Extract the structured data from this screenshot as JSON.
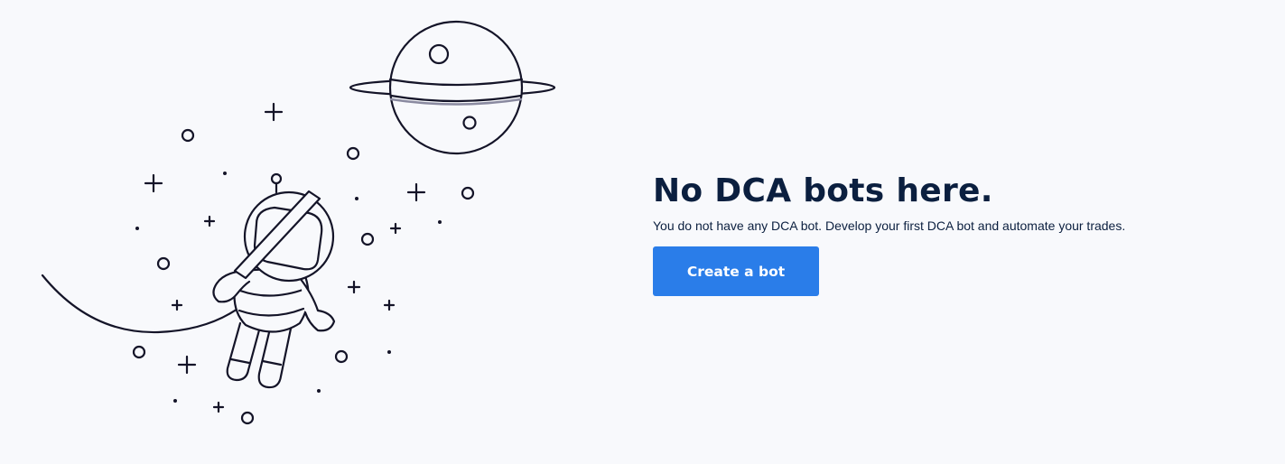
{
  "empty_state": {
    "title": "No DCA bots here.",
    "description": "You do not have any DCA bot. Develop your first DCA bot and automate your trades.",
    "create_button_label": "Create a bot"
  },
  "illustration": {
    "subject": "astronaut-floating-in-space",
    "elements": [
      "planet-icon",
      "astronaut-icon",
      "star-icon",
      "sparkle-icon",
      "moon-arc"
    ]
  },
  "colors": {
    "background": "#f8f9fc",
    "heading_text": "#0b1f3f",
    "line_art": "#141428",
    "primary_button": "#2a7de9",
    "button_text": "#ffffff"
  }
}
